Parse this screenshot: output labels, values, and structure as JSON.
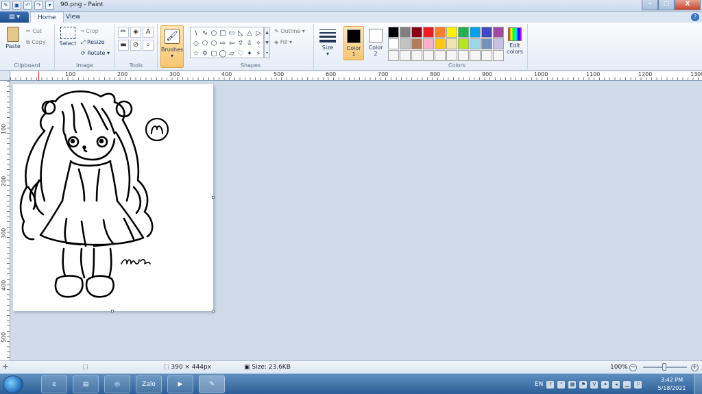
{
  "window": {
    "title": "90.png - Paint",
    "minimize": "–",
    "maximize": "□",
    "close": "X"
  },
  "tabs": {
    "app_menu": "▤ ▾",
    "home": "Home",
    "view": "View",
    "help": "?"
  },
  "clipboard": {
    "group_label": "Clipboard",
    "paste": "Paste",
    "cut": "Cut",
    "copy": "Copy"
  },
  "image": {
    "group_label": "Image",
    "select": "Select",
    "crop": "Crop",
    "resize": "Resize",
    "rotate": "Rotate"
  },
  "tools": {
    "group_label": "Tools",
    "items": [
      "✏",
      "◈",
      "A",
      "▬",
      "⊘",
      "⌕"
    ]
  },
  "brushes": {
    "label": "Brushes"
  },
  "shapes": {
    "group_label": "Shapes",
    "outline": "Outline",
    "fill": "Fill",
    "glyphs": [
      "\\",
      "∿",
      "○",
      "□",
      "▭",
      "◺",
      "△",
      "▷",
      "◇",
      "⬠",
      "⬡",
      "⇨",
      "⇦",
      "⇧",
      "⇩",
      "✧",
      "☆",
      "✡",
      "▢",
      "◯",
      "▱",
      "♡",
      "✦",
      "⚡"
    ]
  },
  "size": {
    "label": "Size"
  },
  "color1": {
    "label_top": "Color",
    "label_bottom": "1",
    "swatch": "#000000"
  },
  "color2": {
    "label_top": "Color",
    "label_bottom": "2",
    "swatch": "#ffffff"
  },
  "colors": {
    "group_label": "Colors",
    "edit_label_top": "Edit",
    "edit_label_bottom": "colors",
    "palette": [
      "#000000",
      "#7f7f7f",
      "#880015",
      "#ed1c24",
      "#ff7f27",
      "#fff200",
      "#22b14c",
      "#00a2e8",
      "#3f48cc",
      "#a349a4",
      "#ffffff",
      "#c3c3c3",
      "#b97a57",
      "#ffaec9",
      "#ffc90e",
      "#efe4b0",
      "#b5e61d",
      "#99d9ea",
      "#7092be",
      "#c8bfe7",
      "#f5f5f5",
      "#f5f5f5",
      "#f5f5f5",
      "#f5f5f5",
      "#f5f5f5",
      "#f5f5f5",
      "#f5f5f5",
      "#f5f5f5",
      "#f5f5f5",
      "#f5f5f5"
    ]
  },
  "ruler": {
    "h_labels": [
      "100",
      "200",
      "300",
      "400",
      "500",
      "600",
      "700",
      "800",
      "900",
      "1000",
      "1100",
      "1200",
      "1300"
    ],
    "v_labels": [
      "100",
      "200",
      "300",
      "400",
      "500"
    ]
  },
  "status": {
    "dims": "390 × 444px",
    "size": "Size: 23.6KB",
    "zoom": "100%"
  },
  "taskbar": {
    "apps": [
      "e",
      "▤",
      "◎",
      "Zalo",
      "▶",
      "✎"
    ],
    "lang": "EN",
    "time": "3:42 PM",
    "date": "5/18/2021"
  }
}
